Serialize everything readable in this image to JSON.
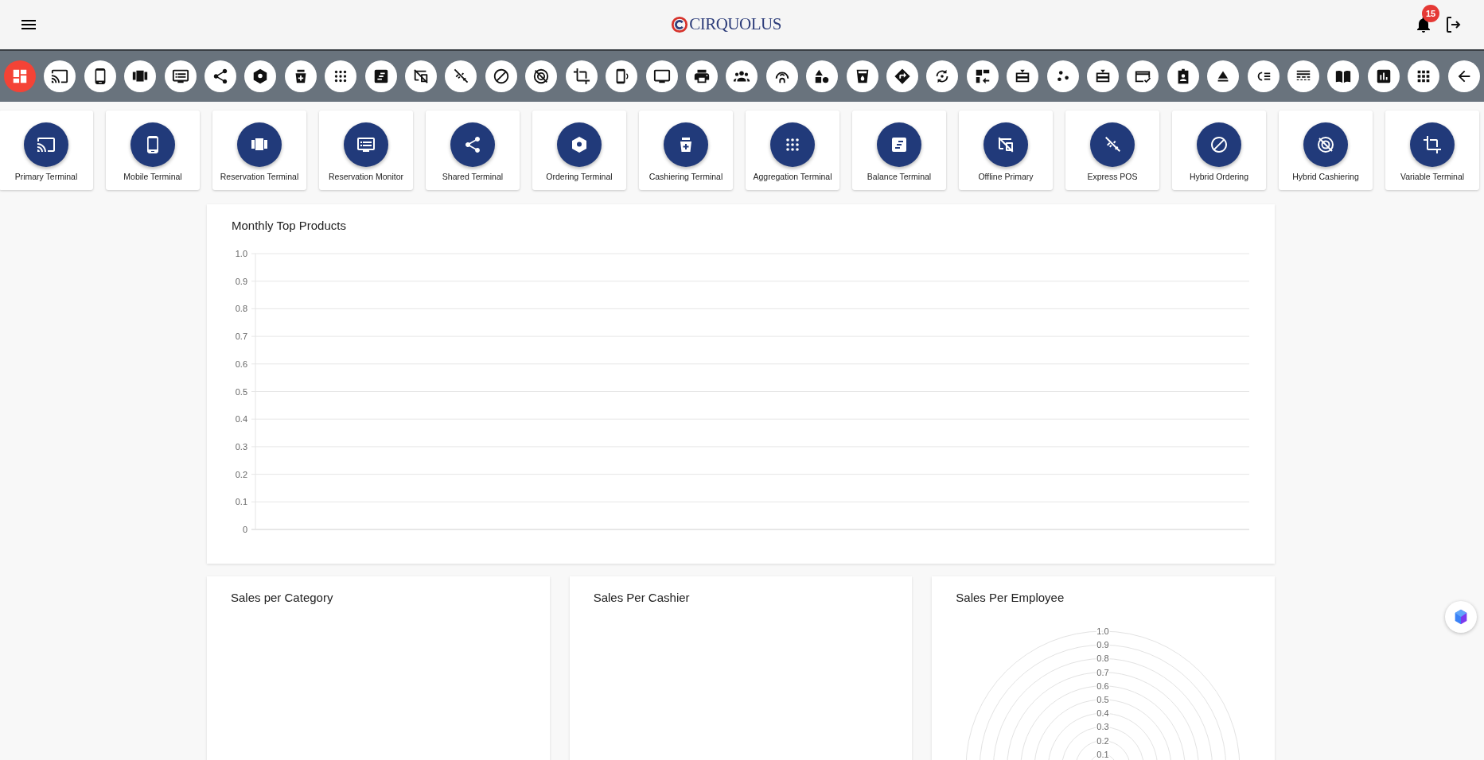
{
  "header": {
    "logo_text": "CIRQUOLUS",
    "notification_count": "15"
  },
  "toolbar": {
    "buttons": [
      {
        "selected": true
      },
      {
        "selected": false
      },
      {
        "selected": false
      },
      {
        "selected": false
      },
      {
        "selected": false
      },
      {
        "selected": false
      },
      {
        "selected": false
      },
      {
        "selected": false
      },
      {
        "selected": false
      },
      {
        "selected": false
      },
      {
        "selected": false
      },
      {
        "selected": false
      },
      {
        "selected": false
      },
      {
        "selected": false
      },
      {
        "selected": false
      },
      {
        "selected": false
      },
      {
        "selected": false
      },
      {
        "selected": false
      },
      {
        "selected": false
      },
      {
        "selected": false
      },
      {
        "selected": false
      },
      {
        "selected": false
      },
      {
        "selected": false
      },
      {
        "selected": false
      },
      {
        "selected": false
      },
      {
        "selected": false
      },
      {
        "selected": false
      },
      {
        "selected": false
      },
      {
        "selected": false
      },
      {
        "selected": false
      },
      {
        "selected": false
      },
      {
        "selected": false
      },
      {
        "selected": false
      },
      {
        "selected": false
      },
      {
        "selected": false
      },
      {
        "selected": false
      },
      {
        "selected": false
      }
    ]
  },
  "tiles": [
    {
      "label": "Primary Terminal"
    },
    {
      "label": "Mobile Terminal"
    },
    {
      "label": "Reservation Terminal"
    },
    {
      "label": "Reservation Monitor"
    },
    {
      "label": "Shared Terminal"
    },
    {
      "label": "Ordering Terminal"
    },
    {
      "label": "Cashiering Terminal"
    },
    {
      "label": "Aggregation Terminal"
    },
    {
      "label": "Balance Terminal"
    },
    {
      "label": "Offline Primary"
    },
    {
      "label": "Express POS"
    },
    {
      "label": "Hybrid Ordering"
    },
    {
      "label": "Hybrid Cashiering"
    },
    {
      "label": "Variable Terminal"
    }
  ],
  "top_products": {
    "title": "Monthly Top Products",
    "y_axis_labels": [
      "1.0",
      "0.9",
      "0.8",
      "0.7",
      "0.6",
      "0.5",
      "0.4",
      "0.3",
      "0.2",
      "0.1",
      "0"
    ]
  },
  "cards": [
    {
      "kind": "empty",
      "title": "Sales per Category"
    },
    {
      "kind": "empty",
      "title": "Sales Per Cashier"
    },
    {
      "kind": "radar",
      "title": "Sales Per Employee",
      "radial_scale": [
        "1.0",
        "0.9",
        "0.8",
        "0.7",
        "0.6",
        "0.5",
        "0.4",
        "0.3",
        "0.2",
        "0.1"
      ]
    }
  ]
}
